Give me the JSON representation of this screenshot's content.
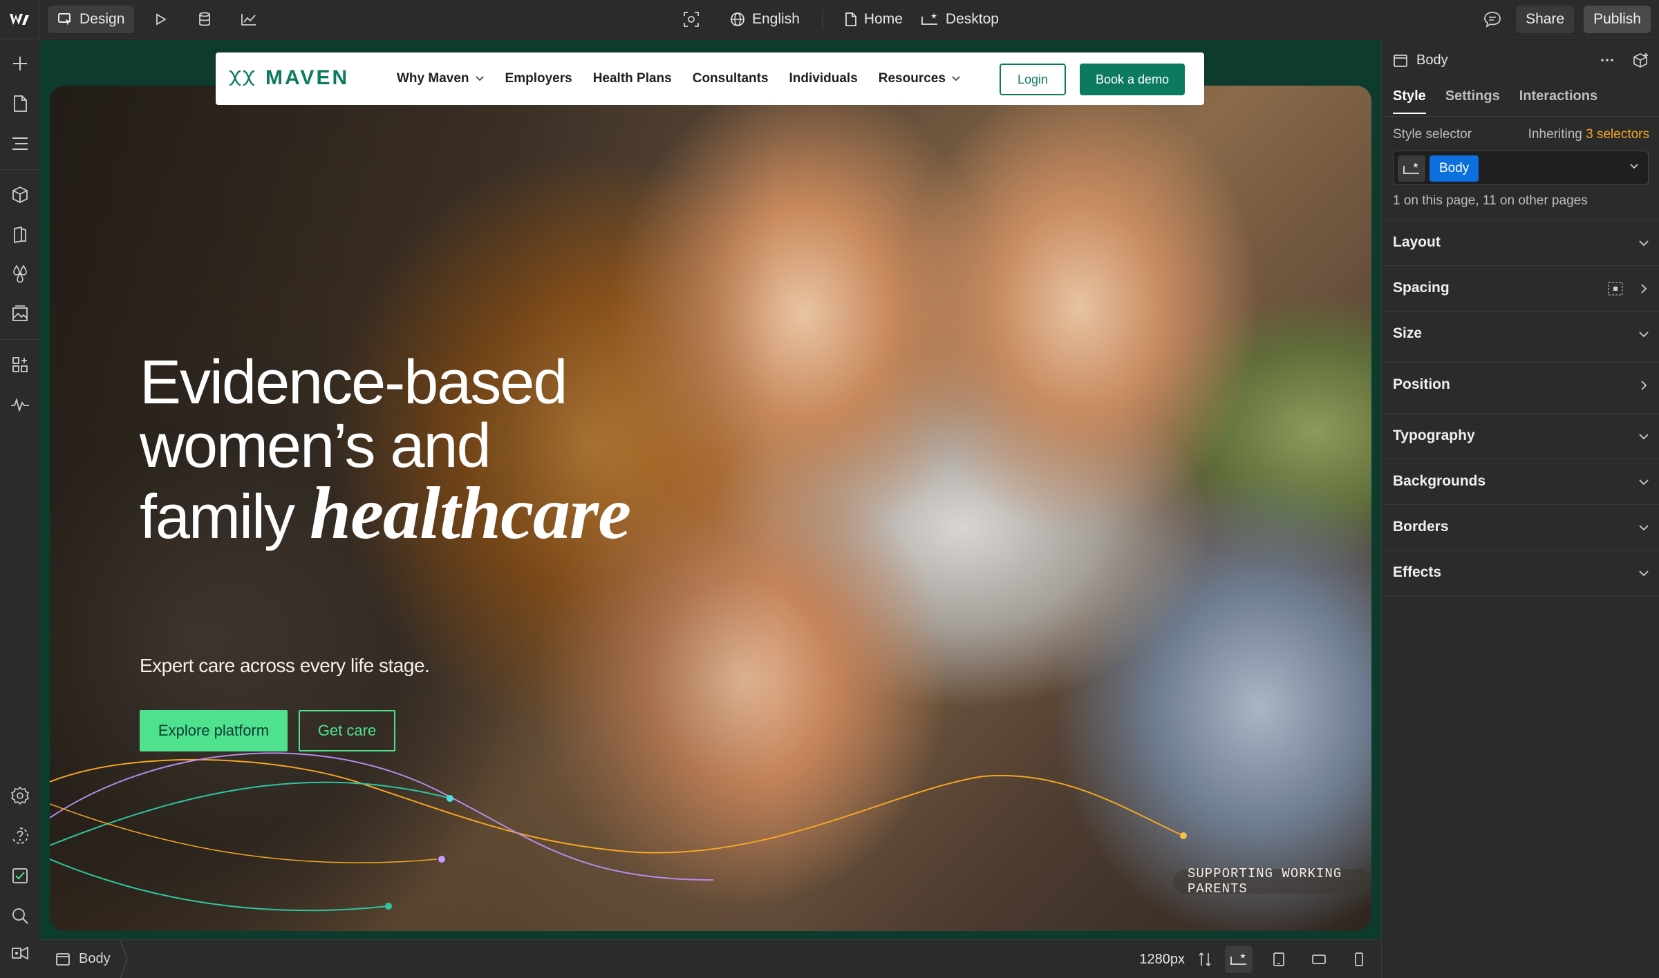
{
  "topbar": {
    "design_label": "Design",
    "language_label": "English",
    "page_label": "Home",
    "breakpoint_label": "Desktop",
    "share_label": "Share",
    "publish_label": "Publish"
  },
  "site": {
    "brand": "MAVEN",
    "nav": [
      "Why Maven",
      "Employers",
      "Health Plans",
      "Consultants",
      "Individuals",
      "Resources"
    ],
    "login_label": "Login",
    "demo_label": "Book a demo",
    "headline_line1": "Evidence-based",
    "headline_line2": "women’s and",
    "headline_line3_plain": "family ",
    "headline_line3_italic": "healthcare",
    "subheadline": "Expert care across every life stage.",
    "explore_label": "Explore platform",
    "getcare_label": "Get care",
    "tag_label": "SUPPORTING WORKING PARENTS"
  },
  "panel": {
    "element_label": "Body",
    "tabs": [
      "Style",
      "Settings",
      "Interactions"
    ],
    "style_selector_label": "Style selector",
    "inheriting_prefix": "Inheriting ",
    "inheriting_count": "3 selectors",
    "selector_chip": "Body",
    "usage_text": "1 on this page, 11 on other pages",
    "sections": [
      "Layout",
      "Spacing",
      "Size",
      "Position",
      "Typography",
      "Backgrounds",
      "Borders",
      "Effects"
    ]
  },
  "bottombar": {
    "breadcrumb": "Body",
    "width_label": "1280px"
  },
  "colors": {
    "brand_green": "#0b7a5e",
    "accent_green": "#4ee28f",
    "selector_blue": "#0b6fde",
    "highlight_orange": "#f5a623"
  }
}
